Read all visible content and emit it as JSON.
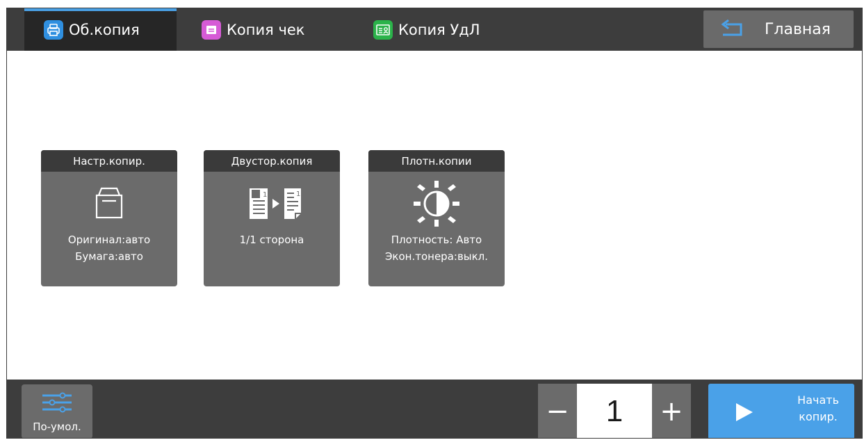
{
  "tabs": [
    {
      "label": "Об.копия",
      "icon": "printer-icon",
      "icon_color": "#2f8fe0",
      "active": true
    },
    {
      "label": "Копия чек",
      "icon": "receipt-icon",
      "icon_color": "#d65bd6",
      "active": false
    },
    {
      "label": "Копия УдЛ",
      "icon": "id-card-icon",
      "icon_color": "#2bb34a",
      "active": false
    }
  ],
  "home": {
    "label": "Главная",
    "icon": "return-arrow-icon"
  },
  "cards": [
    {
      "title": "Настр.копир.",
      "icon": "paper-tray-icon",
      "lines": [
        "Оригинал:авто",
        "Бумага:авто"
      ]
    },
    {
      "title": "Двустор.копия",
      "icon": "duplex-copy-icon",
      "lines": [
        "1/1 сторона"
      ],
      "page_marks": [
        "1",
        "1"
      ]
    },
    {
      "title": "Плотн.копии",
      "icon": "density-icon",
      "lines": [
        "Плотность: Авто",
        "Экон.тонера:выкл."
      ]
    }
  ],
  "bottom": {
    "default_label": "По-умол.",
    "quantity": "1",
    "minus_label": "−",
    "plus_label": "+",
    "start_label_1": "Начать",
    "start_label_2": "копир."
  },
  "colors": {
    "accent": "#4aa1e8",
    "bar": "#3d3d3d",
    "card": "#6b6b6b",
    "card_title": "#3a3a3a"
  }
}
